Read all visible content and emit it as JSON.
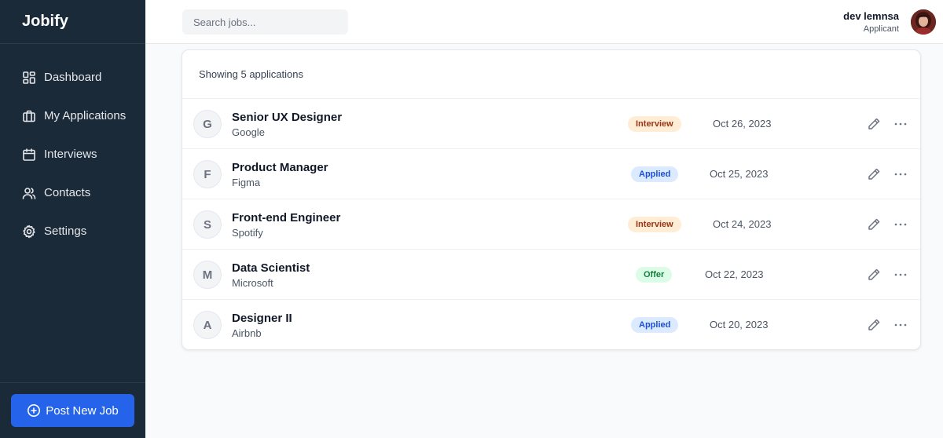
{
  "app": {
    "brand": "Jobify"
  },
  "sidebar": {
    "items": [
      {
        "label": "Dashboard",
        "icon": "grid-icon"
      },
      {
        "label": "My Applications",
        "icon": "briefcase-icon"
      },
      {
        "label": "Interviews",
        "icon": "calendar-icon"
      },
      {
        "label": "Contacts",
        "icon": "users-icon"
      },
      {
        "label": "Settings",
        "icon": "gear-icon"
      }
    ],
    "post_button": "Post New Job"
  },
  "header": {
    "search_placeholder": "Search jobs...",
    "user_name": "dev lemnsa",
    "user_role": "Applicant"
  },
  "applications": {
    "summary": "Showing 5 applications",
    "rows": [
      {
        "initial": "G",
        "title": "Senior UX Designer",
        "company": "Google",
        "status": "Interview",
        "status_type": "interview",
        "date": "Oct 26, 2023"
      },
      {
        "initial": "F",
        "title": "Product Manager",
        "company": "Figma",
        "status": "Applied",
        "status_type": "applied",
        "date": "Oct 25, 2023"
      },
      {
        "initial": "S",
        "title": "Front-end Engineer",
        "company": "Spotify",
        "status": "Interview",
        "status_type": "interview",
        "date": "Oct 24, 2023"
      },
      {
        "initial": "M",
        "title": "Data Scientist",
        "company": "Microsoft",
        "status": "Offer",
        "status_type": "offer",
        "date": "Oct 22, 2023"
      },
      {
        "initial": "A",
        "title": "Designer II",
        "company": "Airbnb",
        "status": "Applied",
        "status_type": "applied",
        "date": "Oct 20, 2023"
      }
    ]
  },
  "colors": {
    "sidebar_bg": "#1b2a38",
    "primary": "#2563eb",
    "interview_bg": "#ffedd5",
    "applied_bg": "#dbeafe",
    "offer_bg": "#dcfce7"
  }
}
